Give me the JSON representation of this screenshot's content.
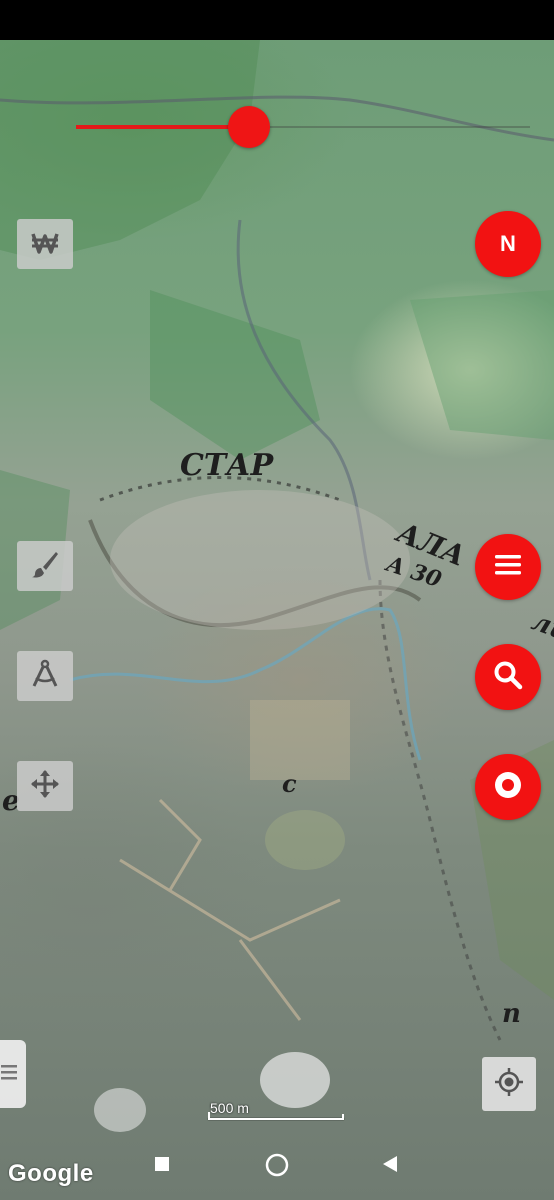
{
  "map": {
    "old_map_text": [
      "СТАР",
      "АЛА",
      "А 30",
      "ли",
      "е",
      "с",
      "п"
    ],
    "scale_label": "500 m",
    "attribution": "Google"
  },
  "opacity_slider": {
    "value": 0.38
  },
  "toolbar_left": {
    "items": [
      {
        "icon": "currency-won-icon"
      },
      {
        "icon": "paint-brush-icon"
      },
      {
        "icon": "compass-drafting-icon"
      },
      {
        "icon": "move-arrows-icon"
      }
    ]
  },
  "right_buttons": {
    "compass_label": "N",
    "items": [
      "menu-icon",
      "search-icon",
      "record-icon"
    ]
  },
  "nav_bar": {
    "items": [
      "recents-square-icon",
      "home-circle-icon",
      "back-triangle-icon"
    ]
  },
  "colors": {
    "accent": "#f21212",
    "button_bg": "#cdcdcd"
  }
}
